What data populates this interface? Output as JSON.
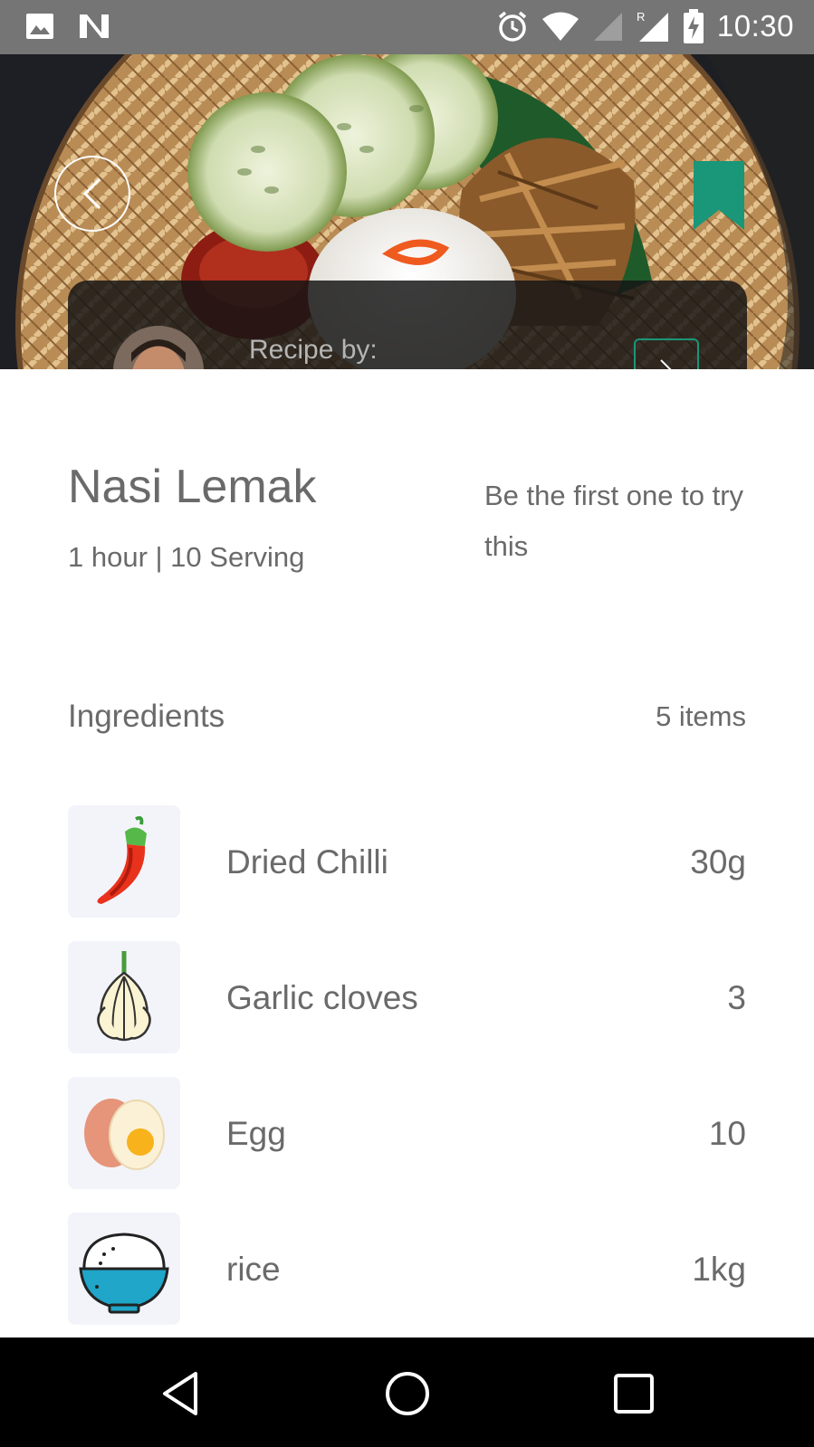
{
  "status_bar": {
    "time": "10:30"
  },
  "author_card": {
    "recipe_by_label": "Recipe by:"
  },
  "recipe": {
    "title": "Nasi Lemak",
    "duration": "1 hour",
    "servings": "10 Serving",
    "meta": "1 hour | 10 Serving",
    "first_try_text": "Be the first one to try this"
  },
  "ingredients": {
    "heading": "Ingredients",
    "count_label": "5 items",
    "items": [
      {
        "name": "Dried Chilli",
        "quantity": "30g",
        "icon": "chilli-icon"
      },
      {
        "name": "Garlic cloves",
        "quantity": "3",
        "icon": "garlic-icon"
      },
      {
        "name": "Egg",
        "quantity": "10",
        "icon": "egg-icon"
      },
      {
        "name": "rice",
        "quantity": "1kg",
        "icon": "rice-bowl-icon"
      }
    ]
  },
  "colors": {
    "accent": "#1a9679",
    "status_bar": "#757575",
    "thumb_bg": "#f3f4fa"
  }
}
